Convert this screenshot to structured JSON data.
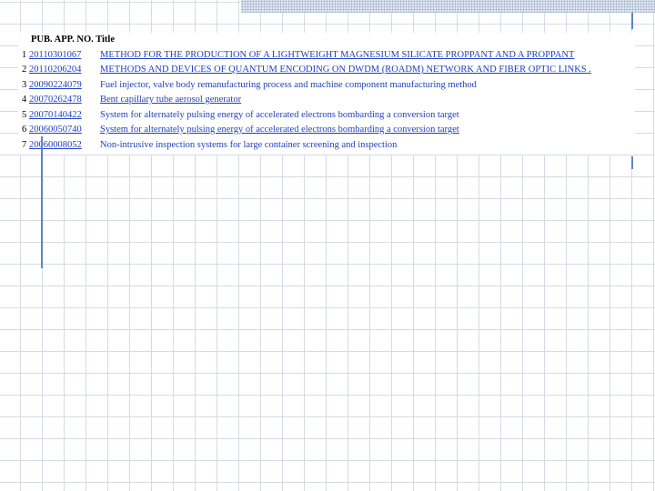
{
  "header": {
    "pub": "PUB. APP. NO.",
    "title": "Title"
  },
  "rows": [
    {
      "num": "1",
      "pub": "20110301067",
      "title": "METHOD FOR THE PRODUCTION OF A LIGHTWEIGHT MAGNESIUM SILICATE PROPPANT AND A PROPPANT"
    },
    {
      "num": "2",
      "pub": "20110206204",
      "title": "METHODS AND DEVICES OF QUANTUM ENCODING ON DWDM (ROADM) NETWORK AND FIBER OPTIC LINKS ."
    },
    {
      "num": "3",
      "pub": "20090224079",
      "title": "Fuel injector, valve body remanufacturing process and machine component manufacturing method"
    },
    {
      "num": "4",
      "pub": "20070262478",
      "title": "Bent capillary tube aerosol generator"
    },
    {
      "num": "5",
      "pub": "20070140422",
      "title": "System for alternately pulsing energy of accelerated electrons bombarding a conversion target"
    },
    {
      "num": "6",
      "pub": "20060050740",
      "title": "System for alternately pulsing energy of accelerated electrons bombarding a conversion target"
    },
    {
      "num": "7",
      "pub": "20060008052",
      "title": "Non-intrusive inspection systems for large container screening and inspection"
    }
  ]
}
